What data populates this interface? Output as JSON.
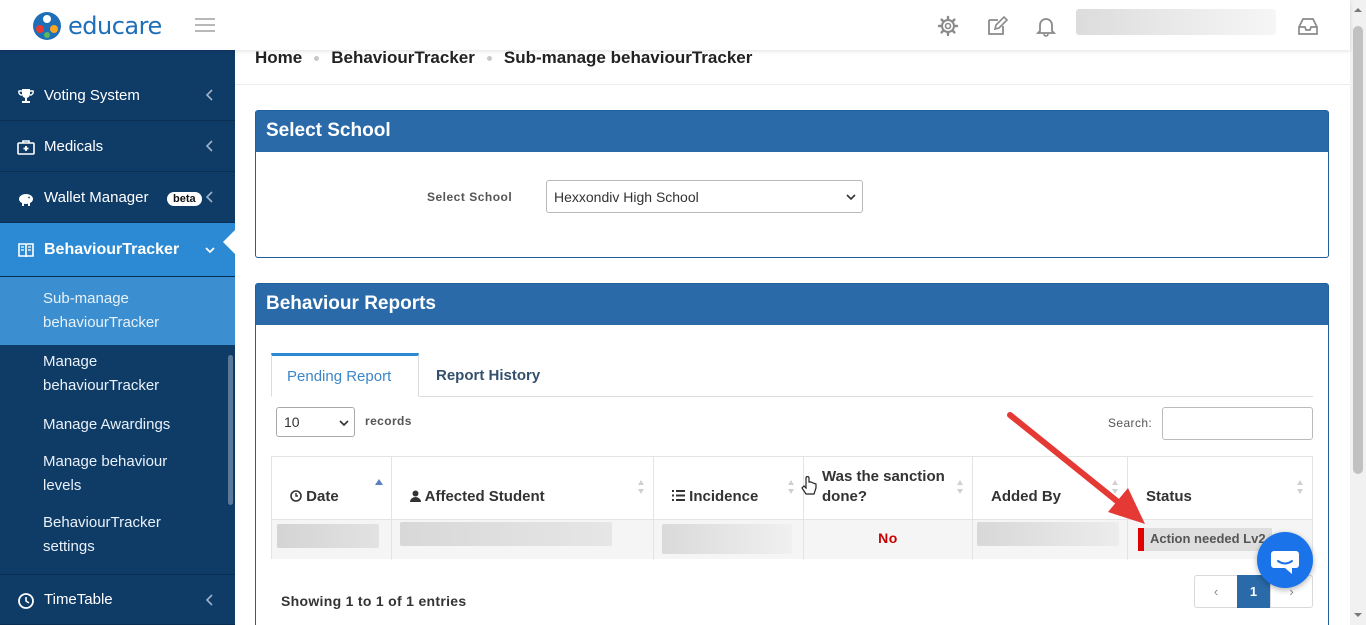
{
  "brand": {
    "name": "educare"
  },
  "topbar": {
    "icons": [
      "gear-icon",
      "edit-icon",
      "bell-icon",
      "inbox-icon"
    ]
  },
  "sidebar": {
    "items": [
      {
        "label": "Voting System",
        "icon": "trophy-icon"
      },
      {
        "label": "Medicals",
        "icon": "medkit-icon"
      },
      {
        "label": "Wallet Manager",
        "icon": "piggy-bank-icon",
        "badge": "beta"
      },
      {
        "label": "BehaviourTracker",
        "icon": "book-icon"
      },
      {
        "label": "TimeTable",
        "icon": "clock-icon"
      }
    ],
    "submenu": [
      {
        "label": "Sub-manage behaviourTracker"
      },
      {
        "label": "Manage behaviourTracker"
      },
      {
        "label": "Manage Awardings"
      },
      {
        "label": "Manage behaviour levels"
      },
      {
        "label": "BehaviourTracker settings"
      }
    ]
  },
  "breadcrumb": [
    "Home",
    "BehaviourTracker",
    "Sub-manage behaviourTracker"
  ],
  "select_school_panel": {
    "title": "Select School",
    "label": "Select School",
    "selected": "Hexxondiv High School"
  },
  "reports_panel": {
    "title": "Behaviour Reports",
    "tabs": [
      "Pending Report",
      "Report History"
    ],
    "records": {
      "value": "10",
      "label": "records"
    },
    "search_label": "Search:",
    "columns": [
      "Date",
      "Affected Student",
      "Incidence",
      "Was the sanction done?",
      "Added By",
      "Status"
    ],
    "column_icons": [
      "clock-icon",
      "user-icon",
      "list-icon",
      "",
      "",
      ""
    ],
    "rows": [
      {
        "sanction_done": "No",
        "status": "Action needed Lv2"
      }
    ],
    "showing": "Showing 1 to 1 of 1 entries",
    "pagination": {
      "prev": "‹",
      "current": "1",
      "next": "›"
    }
  },
  "colors": {
    "sidebar_bg": "#0f3b67",
    "sidebar_active": "#2b8ad3",
    "panel_header": "#2a6aa8",
    "status_flag": "#e00000",
    "annotation_arrow": "#e53935"
  }
}
